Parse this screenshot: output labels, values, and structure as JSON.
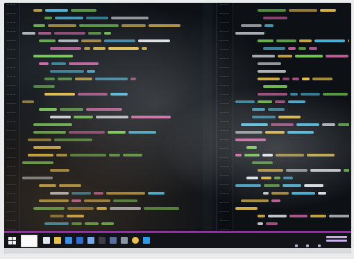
{
  "colors": {
    "taskbar_accent": "#b536c8",
    "keyword": "#4fc3e8",
    "string": "#f2c94c",
    "attr": "#7ed957",
    "tag": "#e06cb0",
    "text": "#e8eef2",
    "editor_bg": "#0d1116"
  },
  "taskbar": {
    "icons": [
      "start-icon",
      "search-icon",
      "task-view-icon",
      "folder-icon",
      "browser-icon",
      "mail-icon",
      "store-icon",
      "terminal-icon",
      "editor-icon",
      "settings-icon",
      "chrome-icon",
      "code-icon"
    ]
  }
}
